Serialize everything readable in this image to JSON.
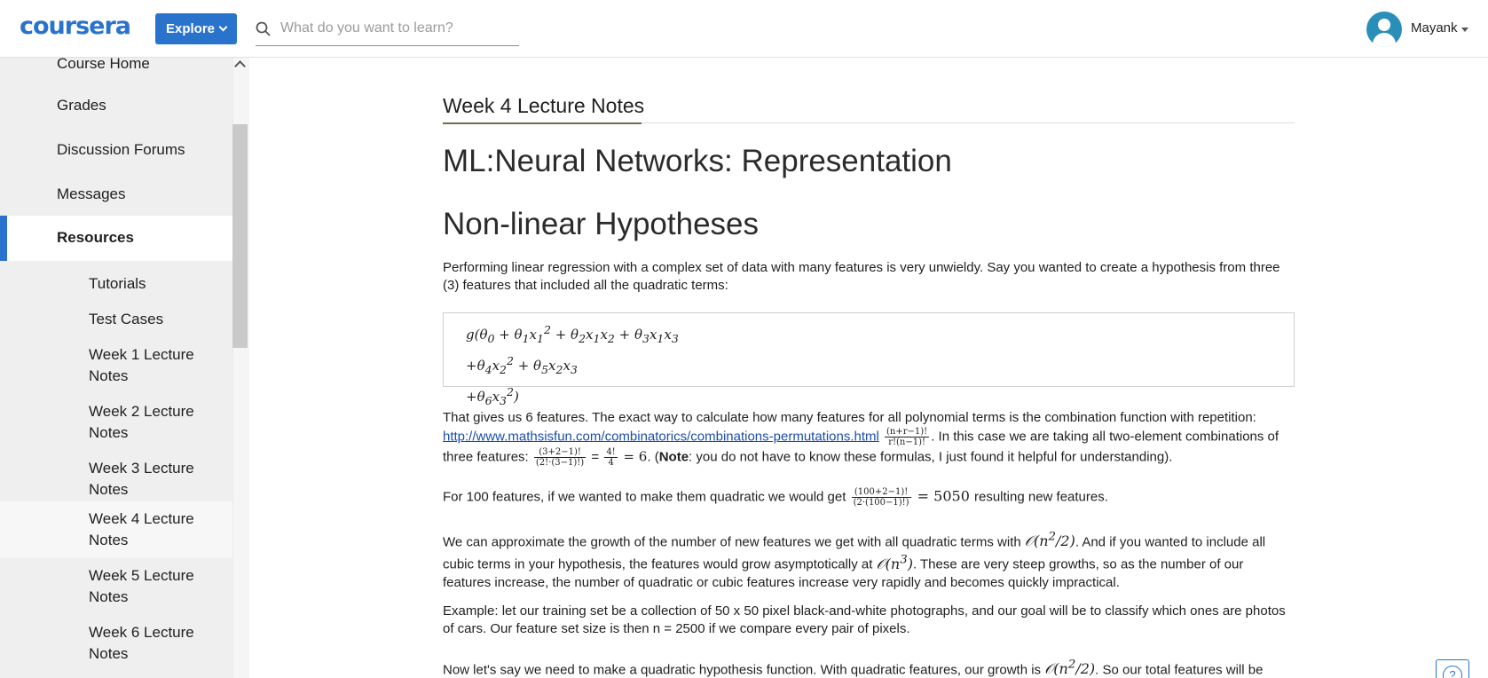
{
  "header": {
    "logo_text": "coursera",
    "explore_label": "Explore",
    "search_placeholder": "What do you want to learn?",
    "username": "Mayank"
  },
  "sidebar": {
    "items": [
      {
        "label": "Course Home"
      },
      {
        "label": "Grades"
      },
      {
        "label": "Discussion Forums"
      },
      {
        "label": "Messages"
      },
      {
        "label": "Resources"
      }
    ],
    "sub_items": [
      {
        "label": "Tutorials"
      },
      {
        "label": "Test Cases"
      },
      {
        "label": "Week 1 Lecture Notes"
      },
      {
        "label": "Week 2 Lecture Notes"
      },
      {
        "label": "Week 3 Lecture Notes"
      },
      {
        "label": "Week 4 Lecture Notes"
      },
      {
        "label": "Week 5 Lecture Notes"
      },
      {
        "label": "Week 6 Lecture Notes"
      }
    ]
  },
  "main": {
    "week_title": "Week 4 Lecture Notes",
    "heading1": "ML:Neural Networks: Representation",
    "heading2": "Non-linear Hypotheses",
    "p1": "Performing linear regression with a complex set of data with many features is very unwieldy. Say you wanted to create a hypothesis from three (3) features that included all the quadratic terms:",
    "p2_a": "That gives us 6 features. The exact way to calculate how many features for all polynomial terms is the combination function with repetition:",
    "p2_link": "http://www.mathsisfun.com/combinatorics/combinations-permutations.html",
    "p2_b": ". In this case we are taking all two-element combinations of three features:",
    "p2_eq": " = ",
    "p2_c": "(",
    "p2_note": "Note",
    "p2_d": ": you do not have to know these formulas, I just found it helpful for understanding).",
    "p3_a": "For 100 features, if we wanted to make them quadratic we would get",
    "p3_b": "resulting new features.",
    "p4_a": "We can approximate the growth of the number of new features we get with all quadratic terms with",
    "p4_b": ". And if you wanted to include all cubic terms in your hypothesis, the features would grow asymptotically at",
    "p4_c": ". These are very steep growths, so as the number of our features increase, the number of quadratic or cubic features increase very rapidly and becomes quickly impractical.",
    "p5": "Example: let our training set be a collection of 50 x 50 pixel black-and-white photographs, and our goal will be to classify which ones are photos of cars. Our feature set size is then n = 2500 if we compare every pair of pixels.",
    "p6_a": "Now let's say we need to make a quadratic hypothesis function. With quadratic features, our growth is",
    "p6_b": ". So our total features will be about",
    "help_label": "?"
  }
}
